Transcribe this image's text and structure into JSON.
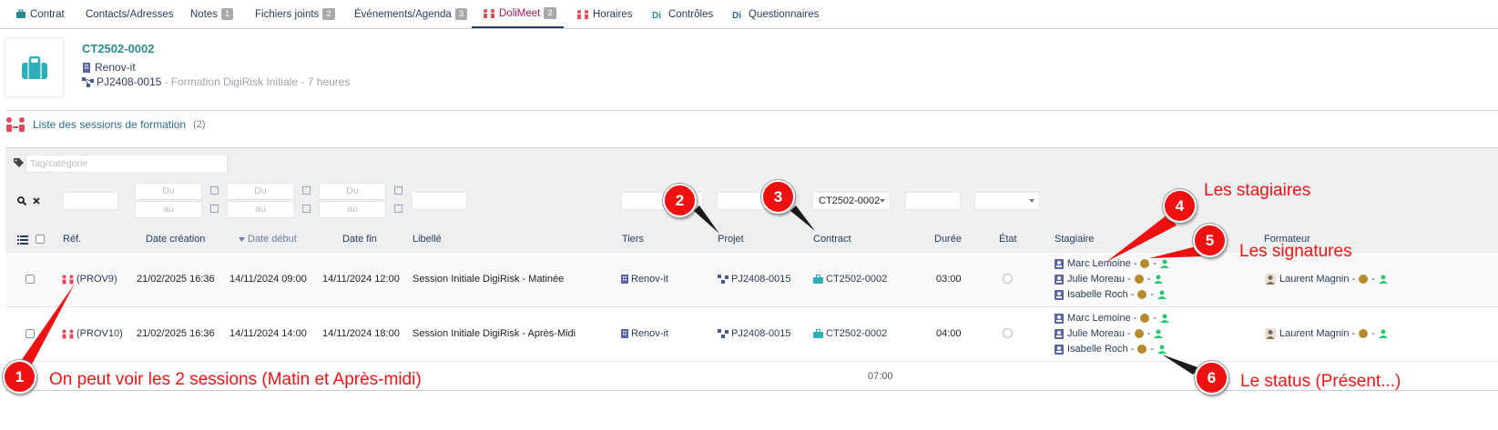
{
  "tabs": [
    {
      "label": "Contrat",
      "badge": ""
    },
    {
      "label": "Contacts/Adresses",
      "badge": ""
    },
    {
      "label": "Notes",
      "badge": "1"
    },
    {
      "label": "Fichiers joints",
      "badge": "2"
    },
    {
      "label": "Événements/Agenda",
      "badge": "3"
    },
    {
      "label": "DoliMeet",
      "badge": "2"
    },
    {
      "label": "Horaires",
      "badge": ""
    },
    {
      "label": "Contrôles",
      "badge": ""
    },
    {
      "label": "Questionnaires",
      "badge": ""
    }
  ],
  "header": {
    "ref": "CT2502-0002",
    "company": "Renov-it",
    "project_ref": "PJ2408-0015",
    "project_desc": " - Formation DigiRisk Initiale - 7 heures"
  },
  "list": {
    "title": "Liste des sessions de formation",
    "count": "(2)"
  },
  "filters": {
    "tag_placeholder": "Tag/catégorie",
    "du": "Du",
    "au": "au",
    "contract_value": "CT2502-0002"
  },
  "columns": {
    "ref": "Réf.",
    "date_creation": "Date création",
    "date_debut": "Date début",
    "date_fin": "Date fin",
    "libelle": "Libellé",
    "tiers": "Tiers",
    "projet": "Projet",
    "contract": "Contract",
    "duree": "Durée",
    "etat": "État",
    "stagiaire": "Stagiaire",
    "formateur": "Formateur"
  },
  "rows": [
    {
      "ref": "(PROV9)",
      "date_creation": "21/02/2025 16:36",
      "date_debut": "14/11/2024 09:00",
      "date_fin": "14/11/2024 12:00",
      "libelle": "Session Initiale DigiRisk - Matinée",
      "tiers": "Renov-it",
      "projet": "PJ2408-0015",
      "contract": "CT2502-0002",
      "duree": "03:00",
      "stagiaires": [
        "Marc Lemoine -",
        "Julie Moreau -",
        "Isabelle Roch -"
      ],
      "formateur": "Laurent Magnin -"
    },
    {
      "ref": "(PROV10)",
      "date_creation": "21/02/2025 16:36",
      "date_debut": "14/11/2024 14:00",
      "date_fin": "14/11/2024 18:00",
      "libelle": "Session Initiale DigiRisk - Après-Midi",
      "tiers": "Renov-it",
      "projet": "PJ2408-0015",
      "contract": "CT2502-0002",
      "duree": "04:00",
      "stagiaires": [
        "Marc Lemoine -",
        "Julie Moreau -",
        "Isabelle Roch -"
      ],
      "formateur": "Laurent Magnin -"
    }
  ],
  "total_duree": "07:00",
  "separator": "-",
  "annotations": {
    "n1": "1",
    "n2": "2",
    "n3": "3",
    "n4": "4",
    "n5": "5",
    "n6": "6",
    "t1": "On peut voir les 2 sessions (Matin et Après-midi)",
    "t4": "Les stagiaires",
    "t5": "Les signatures",
    "t6": "Le status (Présent...)"
  },
  "colors": {
    "accent": "#2b8a91",
    "nav": "#263c5c",
    "annotation": "#f01414",
    "present": "#28c86e",
    "signature": "#b58b2a"
  }
}
